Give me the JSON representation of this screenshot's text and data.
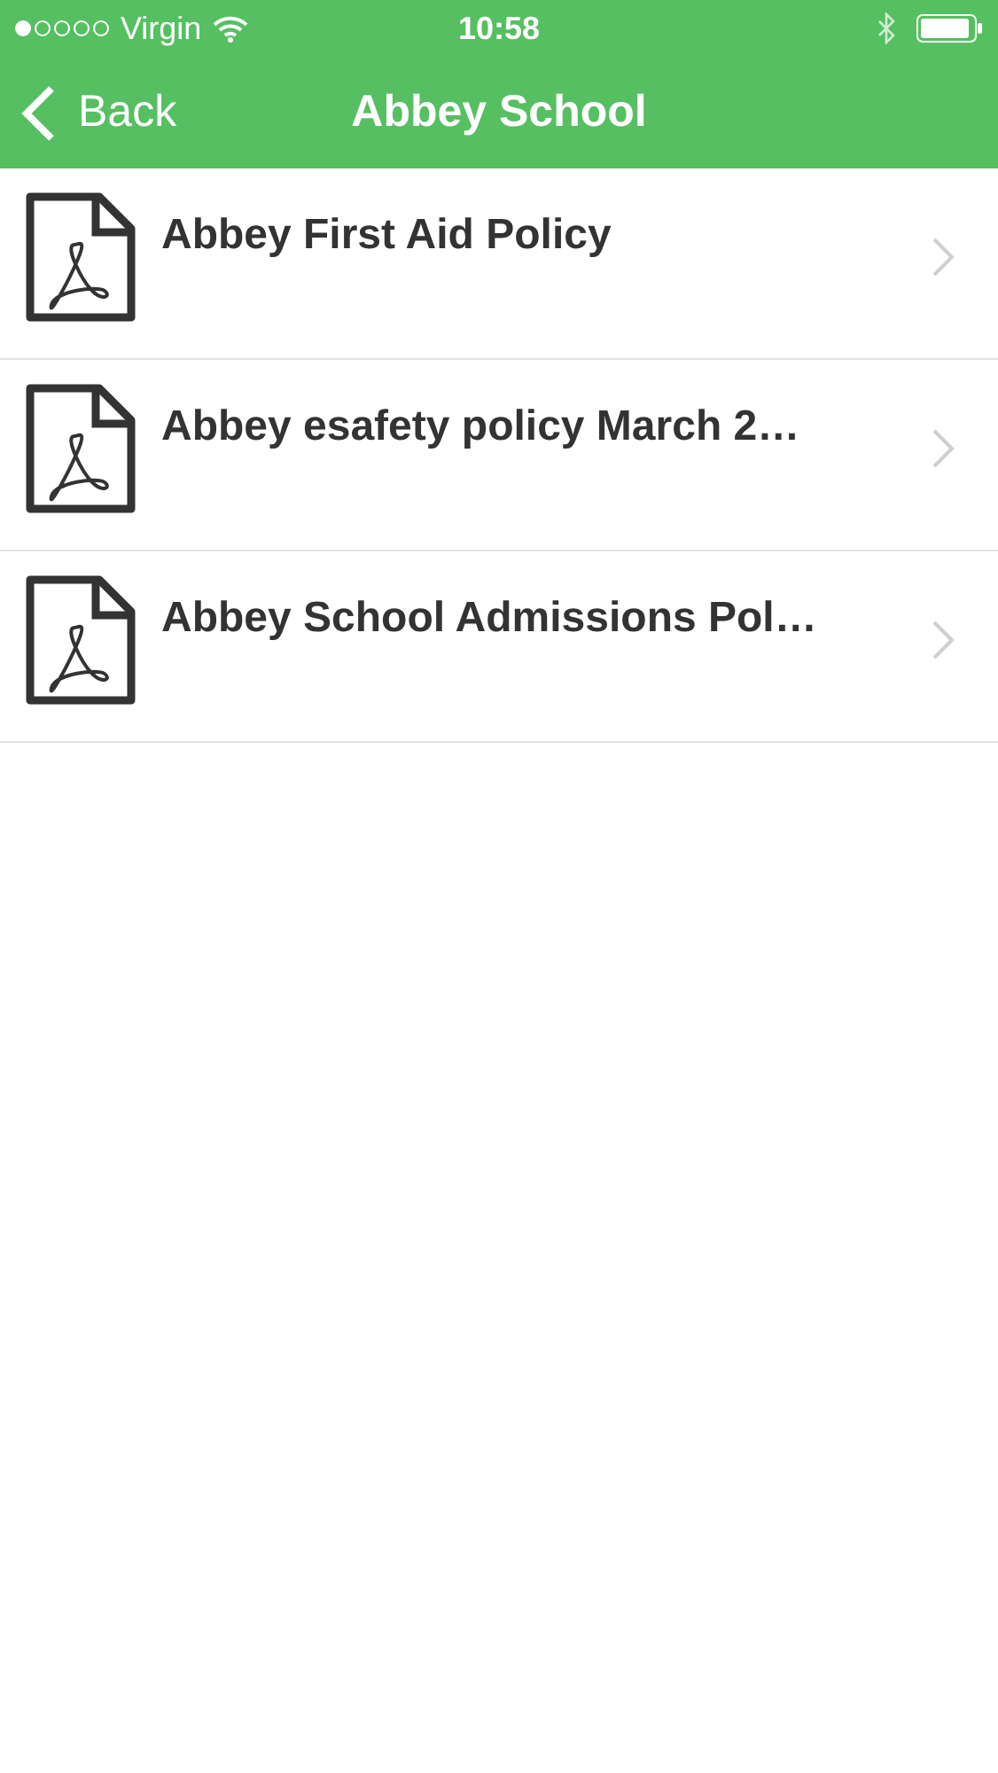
{
  "status_bar": {
    "carrier": "Virgin",
    "time": "10:58"
  },
  "nav_bar": {
    "back": "Back",
    "title": "Abbey School"
  },
  "documents": [
    {
      "title": "Abbey First Aid Policy",
      "kind": "pdf"
    },
    {
      "title": "Abbey esafety policy March 2…",
      "kind": "pdf"
    },
    {
      "title": "Abbey School Admissions Pol…",
      "kind": "pdf"
    }
  ]
}
